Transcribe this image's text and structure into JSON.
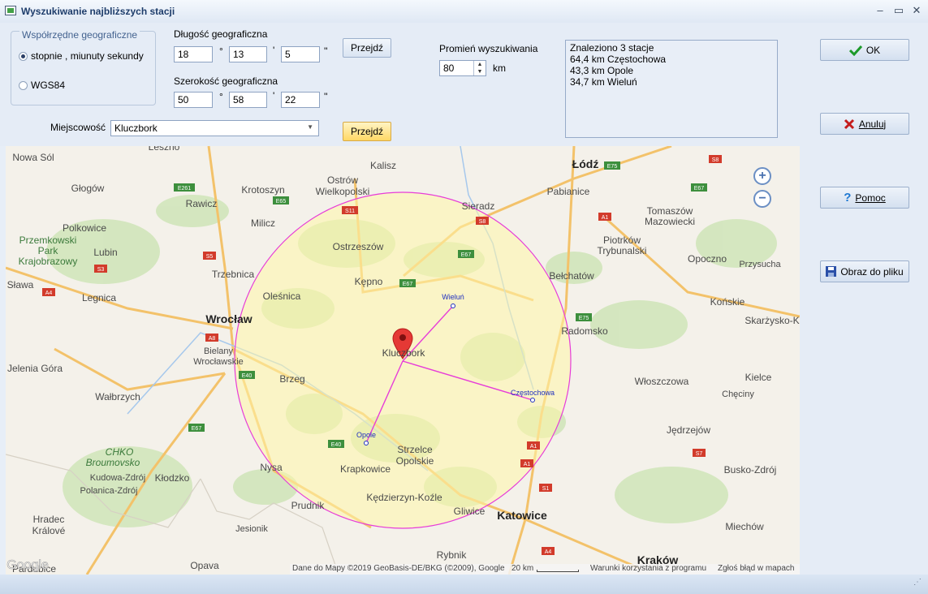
{
  "window": {
    "title": "Wyszukiwanie najbliższych stacji"
  },
  "coords": {
    "group_label": "Współrzędne geograficzne",
    "mode_dms": "stopnie , miunuty sekundy",
    "mode_wgs": "WGS84",
    "lon_label": "Długość geograficzna",
    "lon_deg": "18",
    "lon_min": "13",
    "lon_sec": "5",
    "lat_label": "Szerokość geograficzna",
    "lat_deg": "50",
    "lat_min": "58",
    "lat_sec": "22",
    "deg_sym": "°",
    "min_sym": "'",
    "sec_sym": "''",
    "go_label": "Przejdź"
  },
  "city": {
    "label": "Miejscowość",
    "value": "Kluczbork",
    "go_label": "Przejdź"
  },
  "radius": {
    "label": "Promień wyszukiwania",
    "value": "80",
    "unit": "km"
  },
  "results": {
    "lines": [
      "Znaleziono 3 stacje",
      "64,4 km Częstochowa",
      "43,3 km Opole",
      "34,7 km Wieluń"
    ]
  },
  "actions": {
    "ok": "OK",
    "cancel": "Anuluj",
    "help": "Pomoc",
    "save_image": "Obraz do pliku"
  },
  "map": {
    "attribution": "Dane do Mapy ©2019 GeoBasis-DE/BKG (©2009), Google",
    "scale": "20 km",
    "terms": "Warunki korzystania z programu",
    "report": "Zgłoś błąd w mapach",
    "logo": "Google",
    "zoom_in": "+",
    "zoom_out": "−",
    "center_label": "Kluczbork",
    "station_labels": [
      "Wieluń",
      "Częstochowa",
      "Opole"
    ],
    "places": [
      {
        "name": "Leszno"
      },
      {
        "name": "Kalisz"
      },
      {
        "name": "Łódź"
      },
      {
        "name": "Nowa Sól"
      },
      {
        "name": "Głogów"
      },
      {
        "name": "Rawicz"
      },
      {
        "name": "Krotoszyn"
      },
      {
        "name": "Ostrów"
      },
      {
        "name": "Wielkopolski"
      },
      {
        "name": "Sieradz"
      },
      {
        "name": "Pabianice"
      },
      {
        "name": "Tomaszów"
      },
      {
        "name": "Mazowiecki"
      },
      {
        "name": "Polkowice"
      },
      {
        "name": "Milicz"
      },
      {
        "name": "Ostrzeszów"
      },
      {
        "name": "Piotrków"
      },
      {
        "name": "Trybunalski"
      },
      {
        "name": "Przemkowski"
      },
      {
        "name": "Park"
      },
      {
        "name": "Krajobrazowy"
      },
      {
        "name": "Lubin"
      },
      {
        "name": "Trzebnica"
      },
      {
        "name": "Kępno"
      },
      {
        "name": "Bełchatów"
      },
      {
        "name": "Opoczno"
      },
      {
        "name": "Przysucha"
      },
      {
        "name": "Oleśnica"
      },
      {
        "name": "Legnica"
      },
      {
        "name": "Wrocław"
      },
      {
        "name": "Końskie"
      },
      {
        "name": "Radomsko"
      },
      {
        "name": "Skarżysko-K"
      },
      {
        "name": "Bielany"
      },
      {
        "name": "Wrocławskie"
      },
      {
        "name": "Jelenia Góra"
      },
      {
        "name": "Brzeg"
      },
      {
        "name": "Włoszczowa"
      },
      {
        "name": "Kielce"
      },
      {
        "name": "Chęciny"
      },
      {
        "name": "Wałbrzych"
      },
      {
        "name": "Jędrzejów"
      },
      {
        "name": "CHKO"
      },
      {
        "name": "Broumovsko"
      },
      {
        "name": "Kudowa-Zdrój"
      },
      {
        "name": "Polanica-Zdrój"
      },
      {
        "name": "Kłodzko"
      },
      {
        "name": "Nysa"
      },
      {
        "name": "Krapkowice"
      },
      {
        "name": "Strzelce"
      },
      {
        "name": "Opolskie"
      },
      {
        "name": "Busko-Zdrój"
      },
      {
        "name": "Kędzierzyn-Koźle"
      },
      {
        "name": "Prudnik"
      },
      {
        "name": "Gliwice"
      },
      {
        "name": "Katowice"
      },
      {
        "name": "Hradec"
      },
      {
        "name": "Králové"
      },
      {
        "name": "Jesionik"
      },
      {
        "name": "Rybnik"
      },
      {
        "name": "Kraków"
      },
      {
        "name": "Pardubice"
      },
      {
        "name": "Opava"
      },
      {
        "name": "Miechów"
      },
      {
        "name": "Sława"
      }
    ],
    "roads": [
      "E261",
      "E75",
      "S8",
      "E67",
      "S11",
      "E65",
      "S5",
      "S3",
      "S8",
      "A4",
      "E67",
      "A1",
      "E75",
      "A8",
      "E40",
      "E40",
      "E67",
      "A1",
      "S1",
      "S7",
      "A4",
      "E67",
      "A1"
    ]
  }
}
